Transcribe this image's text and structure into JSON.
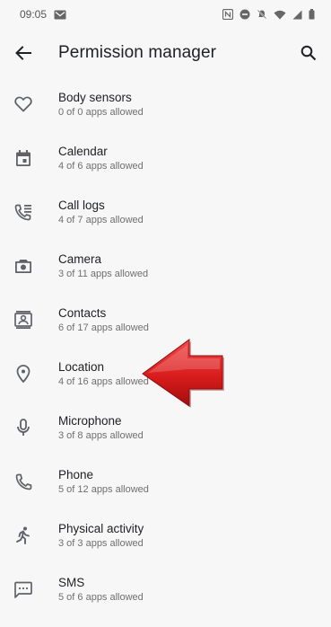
{
  "status_bar": {
    "time": "09:05",
    "icons": [
      "gmail-icon",
      "nfc-icon",
      "dnd-icon",
      "mute-icon",
      "wifi-icon",
      "signal-icon",
      "battery-icon"
    ]
  },
  "header": {
    "title": "Permission manager",
    "back_icon": "arrow-back-icon",
    "search_icon": "search-icon"
  },
  "permissions": [
    {
      "label": "Body sensors",
      "sub": "0 of 0 apps allowed",
      "icon": "heart-icon"
    },
    {
      "label": "Calendar",
      "sub": "4 of 6 apps allowed",
      "icon": "calendar-icon"
    },
    {
      "label": "Call logs",
      "sub": "4 of 7 apps allowed",
      "icon": "call-log-icon"
    },
    {
      "label": "Camera",
      "sub": "3 of 11 apps allowed",
      "icon": "camera-icon"
    },
    {
      "label": "Contacts",
      "sub": "6 of 17 apps allowed",
      "icon": "contacts-icon"
    },
    {
      "label": "Location",
      "sub": "4 of 16 apps allowed",
      "icon": "location-pin-icon"
    },
    {
      "label": "Microphone",
      "sub": "3 of 8 apps allowed",
      "icon": "microphone-icon"
    },
    {
      "label": "Phone",
      "sub": "5 of 12 apps allowed",
      "icon": "phone-icon"
    },
    {
      "label": "Physical activity",
      "sub": "3 of 3 apps allowed",
      "icon": "walking-icon"
    },
    {
      "label": "SMS",
      "sub": "5 of 6 apps allowed",
      "icon": "sms-icon"
    }
  ],
  "annotation": {
    "icon": "red-arrow-icon",
    "color": "#d91c1c",
    "points_to": "Location"
  }
}
